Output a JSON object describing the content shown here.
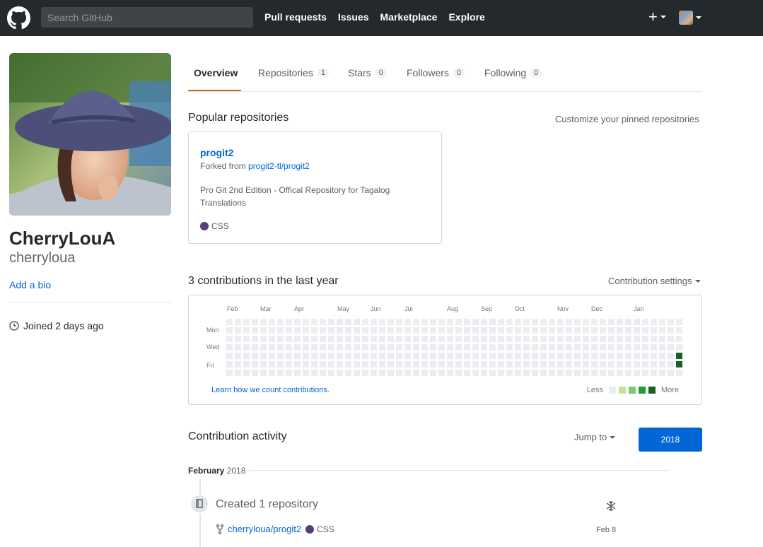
{
  "header": {
    "search_placeholder": "Search GitHub",
    "nav": [
      "Pull requests",
      "Issues",
      "Marketplace",
      "Explore"
    ],
    "plus_label": "+"
  },
  "profile": {
    "fullname": "CherryLouA",
    "username": "cherryloua",
    "add_bio": "Add a bio",
    "joined": "Joined 2 days ago"
  },
  "tabs": [
    {
      "label": "Overview",
      "count": null,
      "selected": true
    },
    {
      "label": "Repositories",
      "count": "1"
    },
    {
      "label": "Stars",
      "count": "0"
    },
    {
      "label": "Followers",
      "count": "0"
    },
    {
      "label": "Following",
      "count": "0"
    }
  ],
  "popular": {
    "title": "Popular repositories",
    "customize": "Customize your pinned repositories",
    "repo": {
      "name": "progit2",
      "forked_prefix": "Forked from ",
      "forked_from": "progit2-tl/progit2",
      "description": "Pro Git 2nd Edition - Offical Repository for Tagalog Translations",
      "language": "CSS",
      "language_color": "#563d7c"
    }
  },
  "contributions": {
    "title": "3 contributions in the last year",
    "settings": "Contribution settings",
    "months": [
      "Feb",
      "Mar",
      "Apr",
      "May",
      "Jun",
      "Jul",
      "Aug",
      "Sep",
      "Oct",
      "Nov",
      "Dec",
      "Jan"
    ],
    "days": [
      "Mon",
      "Wed",
      "Fri"
    ],
    "learn": "Learn how we count contributions.",
    "legend_less": "Less",
    "legend_more": "More",
    "colors": [
      "#ebedf0",
      "#c6e48b",
      "#7bc96f",
      "#239a3b",
      "#196127"
    ],
    "active_cells": [
      {
        "week": 53,
        "day": 4,
        "level": 4
      },
      {
        "week": 53,
        "day": 5,
        "level": 4
      }
    ]
  },
  "activity": {
    "title": "Contribution activity",
    "jump_to": "Jump to",
    "year": "2018",
    "month_label": "February",
    "month_year": "2018",
    "item_title": "Created 1 repository",
    "repo": "cherryloua/progit2",
    "language": "CSS",
    "date": "Feb 8"
  }
}
